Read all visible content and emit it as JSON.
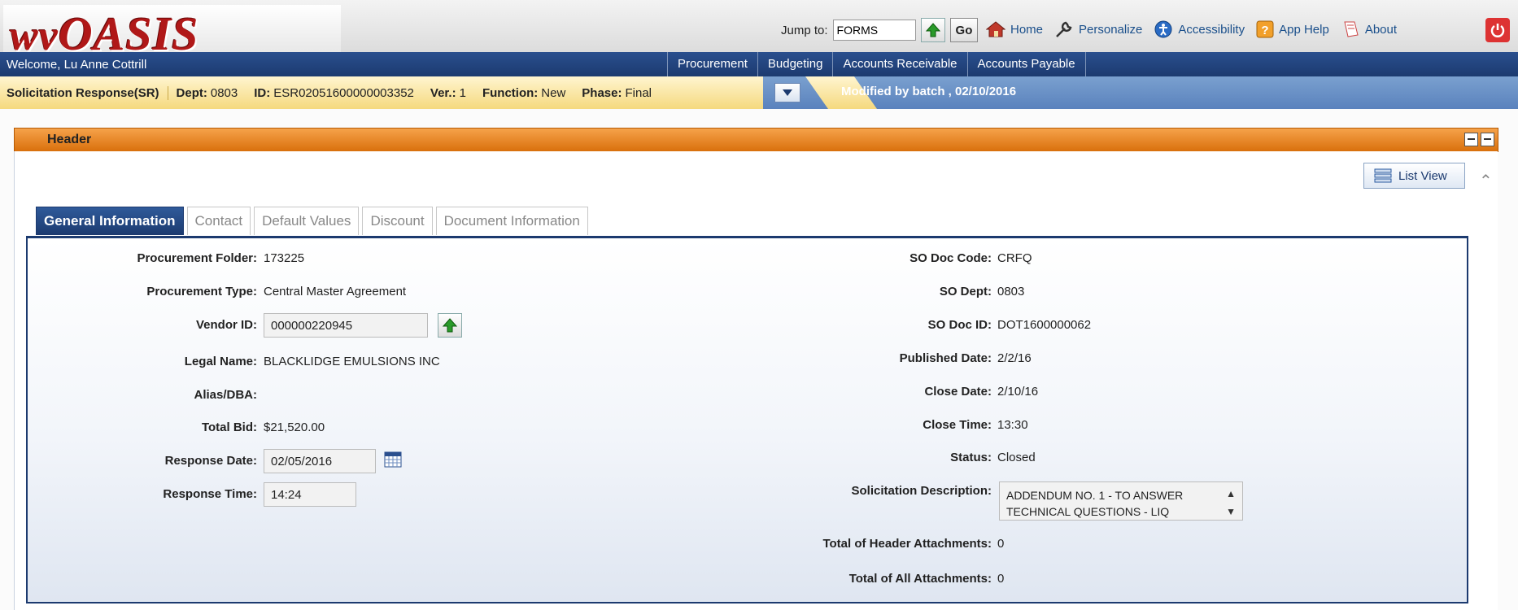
{
  "app": {
    "logo_text_wv": "wv",
    "logo_text_main": "OASIS",
    "jump_label": "Jump to:",
    "jump_value": "FORMS",
    "go_label": "Go",
    "top_links": [
      "Home",
      "Personalize",
      "Accessibility",
      "App Help",
      "About"
    ]
  },
  "nav": {
    "welcome": "Welcome, Lu Anne Cottrill",
    "menus": [
      "Procurement",
      "Budgeting",
      "Accounts Receivable",
      "Accounts Payable"
    ]
  },
  "docbar": {
    "doc_type": "Solicitation Response(SR)",
    "dept_label": "Dept:",
    "dept": "0803",
    "id_label": "ID:",
    "id": "ESR02051600000003352",
    "ver_label": "Ver.:",
    "ver": "1",
    "function_label": "Function:",
    "function": "New",
    "phase_label": "Phase:",
    "phase": "Final",
    "modified": "Modified by batch , 02/10/2016"
  },
  "section": {
    "header_title": "Header",
    "list_view": "List View"
  },
  "tabs": [
    "General Information",
    "Contact",
    "Default Values",
    "Discount",
    "Document Information"
  ],
  "form": {
    "procurement_folder": {
      "label": "Procurement Folder:",
      "value": "173225"
    },
    "procurement_type": {
      "label": "Procurement Type:",
      "value": "Central Master Agreement"
    },
    "vendor_id": {
      "label": "Vendor ID:",
      "value": "000000220945"
    },
    "legal_name": {
      "label": "Legal Name:",
      "value": "BLACKLIDGE EMULSIONS INC"
    },
    "alias_dba": {
      "label": "Alias/DBA:",
      "value": ""
    },
    "total_bid": {
      "label": "Total Bid:",
      "value": "$21,520.00"
    },
    "response_date": {
      "label": "Response Date:",
      "value": "02/05/2016"
    },
    "response_time": {
      "label": "Response Time:",
      "value": "14:24"
    },
    "so_doc_code": {
      "label": "SO Doc Code:",
      "value": "CRFQ"
    },
    "so_dept": {
      "label": "SO Dept:",
      "value": "0803"
    },
    "so_doc_id": {
      "label": "SO Doc ID:",
      "value": "DOT1600000062"
    },
    "published_date": {
      "label": "Published Date:",
      "value": "2/2/16"
    },
    "close_date": {
      "label": "Close Date:",
      "value": "2/10/16"
    },
    "close_time": {
      "label": "Close Time:",
      "value": "13:30"
    },
    "status": {
      "label": "Status:",
      "value": "Closed"
    },
    "solicitation_description": {
      "label": "Solicitation Description:",
      "value": "ADDENDUM NO. 1 - TO ANSWER TECHNICAL QUESTIONS - LIQ"
    },
    "total_header_attachments": {
      "label": "Total of Header Attachments:",
      "value": "0"
    },
    "total_all_attachments": {
      "label": "Total of All Attachments:",
      "value": "0"
    }
  }
}
